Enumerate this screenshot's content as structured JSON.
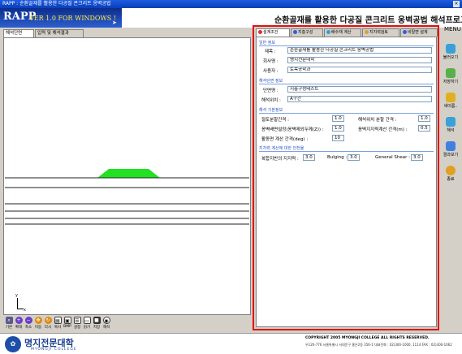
{
  "window": {
    "title": "RAPP : 순환골재를 활용한 다공질 콘크리트 옹벽공법",
    "close_glyph": "×"
  },
  "banner": {
    "logo_main": "RAPP",
    "logo_version": "VER 1.0 FOR WINDOWS !",
    "app_title": "순환골재를 활용한 다공질 콘크리트 옹벽공법 해석프로그램",
    "menu_label": "MENU"
  },
  "left_tabs": [
    {
      "label": "해석단면",
      "active": true
    },
    {
      "label": "입력 및 해석결과",
      "active": false
    }
  ],
  "canvas": {
    "axis_y_label": "y",
    "axis_x_label": "x",
    "slope_color": "#22e022"
  },
  "toolbar": [
    {
      "label": "기본",
      "icon": "default-view-icon",
      "color": "#5a5a8c"
    },
    {
      "label": "확대",
      "icon": "zoom-in-icon",
      "color": "#6a3fc8"
    },
    {
      "label": "축소",
      "icon": "zoom-out-icon",
      "color": "#6a3fc8"
    },
    {
      "label": "이동",
      "icon": "pan-icon",
      "color": "#e08a10"
    },
    {
      "label": "다시",
      "icon": "redraw-icon",
      "color": "#e08a10"
    },
    {
      "label": "복사",
      "icon": "copy-icon",
      "color": "#404040"
    },
    {
      "label": "BMP",
      "icon": "bmp-icon",
      "color": "#404040"
    },
    {
      "label": "설정",
      "icon": "settings-icon",
      "color": "#404040"
    },
    {
      "label": "읽기",
      "icon": "open-icon",
      "color": "#404040"
    },
    {
      "label": "저장",
      "icon": "save-icon",
      "color": "#404040"
    },
    {
      "label": "해석",
      "icon": "analyze-icon",
      "color": "#404040"
    }
  ],
  "right_tabs": [
    {
      "label": "설계조건",
      "dot": "#e03030",
      "active": true
    },
    {
      "label": "지층구성",
      "dot": "#3060e0",
      "active": false
    },
    {
      "label": "배수재 계산",
      "dot": "#30a0e0",
      "active": false
    },
    {
      "label": "지지력검토",
      "dot": "#e0a030",
      "active": false
    },
    {
      "label": "비탈면 설계",
      "dot": "#3060e0",
      "active": false
    }
  ],
  "form": {
    "general": {
      "section_title": "일반 정보",
      "title_label": "제목 :",
      "title_value": "순환골재를 활용한 다공질 콘크리트 옹벽공법",
      "company_label": "회사명 :",
      "company_value": "명지전문대학",
      "user_label": "사용자 :",
      "user_value": "토목공학과"
    },
    "section": {
      "section_title": "해석단면 정보",
      "name_label": "단면명 :",
      "name_value": "지층구성테스트",
      "location_label": "해석위치 :",
      "location_value": "A구간"
    },
    "analysis": {
      "section_title": "해석 기본정보",
      "slice_label": "절토분할간격 :",
      "slice_value": "1.0",
      "analysis_pos_label": "해석위치 분할 간격 :",
      "analysis_pos_value": "1.0",
      "wall_label": "옹벽배면설정(옹벽제외두께(Z)) :",
      "wall_value": "1.0",
      "bearing_label": "옹벽지지력계산 간격(m) :",
      "bearing_value": "0.5",
      "slip_label": "활동면 계산 간격(deg) :",
      "slip_value": "10"
    },
    "support": {
      "section_title": "지지력 계산에 대한 안전율",
      "compound_label": "복합지반의 지지력 :",
      "compound_value": "3.0",
      "bulging_label": "Bulging :",
      "bulging_value": "3.0",
      "shear_label": "General Shear :",
      "shear_value": "3.0"
    }
  },
  "side_menu": [
    {
      "label": "불러오기",
      "icon": "load-icon",
      "color": "#3aa0d8"
    },
    {
      "label": "저장하기",
      "icon": "save-file-icon",
      "color": "#58b048"
    },
    {
      "label": "새이름..",
      "icon": "rename-icon",
      "color": "#e0b020"
    },
    {
      "label": "해석",
      "icon": "analysis-run-icon",
      "color": "#3aa0d8"
    },
    {
      "label": "결과보기",
      "icon": "results-icon",
      "color": "#4080e0"
    },
    {
      "label": "종료",
      "icon": "exit-icon",
      "color": "#e0a020"
    }
  ],
  "footer": {
    "college_name": "명지전문대학",
    "college_eng": "MYONGJI COLLEGE",
    "copyright": "COPYRIGHT 2005 MYONGJI COLLEGE ALL RIGHTS RESERVED.",
    "address": "우120-776 서울특별시 서대문구 홍은2동 356-1 대표전화 : 02)300-1000, 1114 FAX : 02)300-1062"
  },
  "colors": {
    "highlight_border": "#e31010",
    "title_bar": "#1c5ce0"
  }
}
